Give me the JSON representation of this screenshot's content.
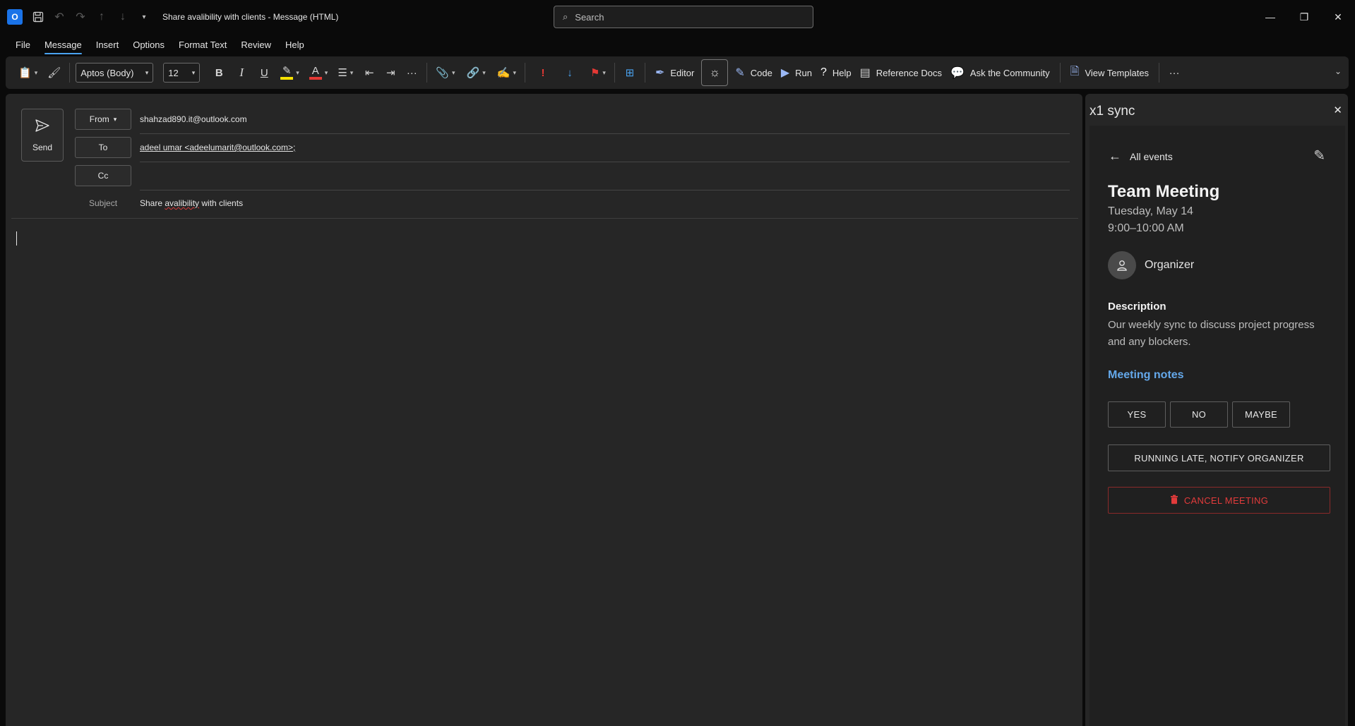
{
  "titlebar": {
    "window_title": "Share avalibility with clients  -  Message (HTML)",
    "search_placeholder": "Search"
  },
  "menu": {
    "items": [
      "File",
      "Message",
      "Insert",
      "Options",
      "Format Text",
      "Review",
      "Help"
    ],
    "active": "Message"
  },
  "ribbon": {
    "font_name": "Aptos (Body)",
    "font_size": "12",
    "editor_label": "Editor",
    "code_label": "Code",
    "run_label": "Run",
    "help_label": "Help",
    "reference_docs_label": "Reference Docs",
    "ask_community_label": "Ask the Community",
    "view_templates_label": "View Templates"
  },
  "compose": {
    "send_label": "Send",
    "from_label": "From",
    "from_value": "shahzad890.it@outlook.com",
    "to_label": "To",
    "to_value": "adeel umar <adeelumarit@outlook.com>;",
    "cc_label": "Cc",
    "cc_value": "",
    "subject_label": "Subject",
    "subject_prefix": "Share ",
    "subject_misspelled": "avalibility",
    "subject_suffix": " with clients"
  },
  "panel": {
    "title": "x1 sync",
    "back_label": "All events",
    "event_title": "Team Meeting",
    "event_date": "Tuesday, May 14",
    "event_time": "9:00–10:00 AM",
    "organizer_label": "Organizer",
    "description_heading": "Description",
    "description_text": "Our weekly sync to discuss project progress and any blockers.",
    "meeting_notes_label": "Meeting notes",
    "yes_label": "YES",
    "no_label": "NO",
    "maybe_label": "MAYBE",
    "running_late_label": "RUNNING LATE, NOTIFY ORGANIZER",
    "cancel_label": "CANCEL MEETING"
  },
  "colors": {
    "accent": "#4aa3f0",
    "link": "#64a8ea",
    "danger": "#e23b3b",
    "highlight": "#f5e100",
    "font_color": "#e53935",
    "flag": "#e53935",
    "importance": "#e53935"
  },
  "icons": [
    "outlook-icon",
    "save-icon",
    "undo-icon",
    "redo-icon",
    "up-icon",
    "down-icon",
    "customize-qat-icon",
    "search-icon",
    "minimize-icon",
    "restore-icon",
    "close-icon",
    "paste-icon",
    "format-painter-icon",
    "bold-icon",
    "italic-icon",
    "underline-icon",
    "highlight-icon",
    "font-color-icon",
    "bullets-icon",
    "decrease-indent-icon",
    "increase-indent-icon",
    "more-icon",
    "attach-icon",
    "link-icon",
    "signature-icon",
    "importance-high-icon",
    "importance-low-icon",
    "flag-icon",
    "apps-icon",
    "editor-icon",
    "theme-icon",
    "code-icon",
    "run-icon",
    "help-icon",
    "reference-docs-icon",
    "community-icon",
    "templates-icon",
    "send-icon",
    "arrow-left-icon",
    "pencil-icon",
    "person-icon",
    "trash-icon"
  ]
}
